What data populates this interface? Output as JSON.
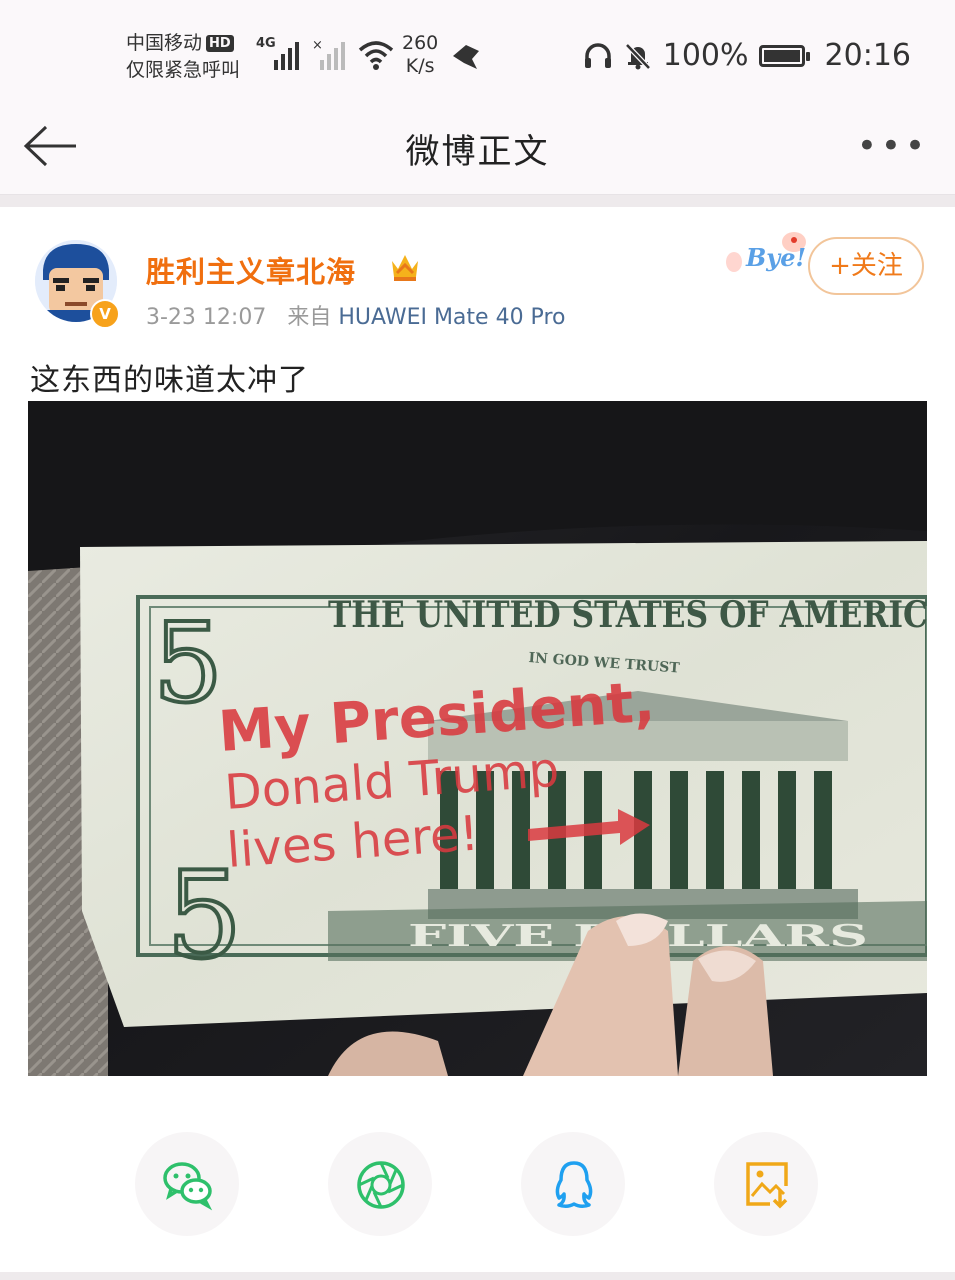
{
  "status_bar": {
    "carrier": "中国移动",
    "carrier_badge": "HD",
    "emergency": "仅限紧急呼叫",
    "network": "4G",
    "speed_value": "260",
    "speed_unit": "K/s",
    "battery": "100%",
    "battery_level": 1.0,
    "time": "20:16"
  },
  "nav": {
    "title": "微博正文",
    "more": "•••"
  },
  "post": {
    "username": "胜利主义章北海",
    "verified_badge": "V",
    "time": "3-23 12:07",
    "source_prefix": "来自",
    "device": "HUAWEI Mate 40 Pro",
    "follow_label": "+关注",
    "sticker_text": "Bye!",
    "text": "这东西的味道太冲了"
  },
  "photo": {
    "bill_top_text": "THE UNITED STATES OF AMERIC",
    "motto": "IN GOD WE TRUST",
    "stamp_line1": "My President,",
    "stamp_line2": "Donald Trump",
    "stamp_line3": "lives here!",
    "denomination": "5",
    "bottom_text": "FIVE DOLLARS"
  },
  "share": {
    "icons": [
      "wechat-icon",
      "moments-icon",
      "qq-icon",
      "save-image-icon"
    ]
  },
  "colors": {
    "accent_orange": "#f06f0f",
    "device_blue": "#4a6b94",
    "wechat_green": "#2ec06b",
    "qq_blue": "#1fa0f0",
    "save_orange": "#f0a818"
  }
}
